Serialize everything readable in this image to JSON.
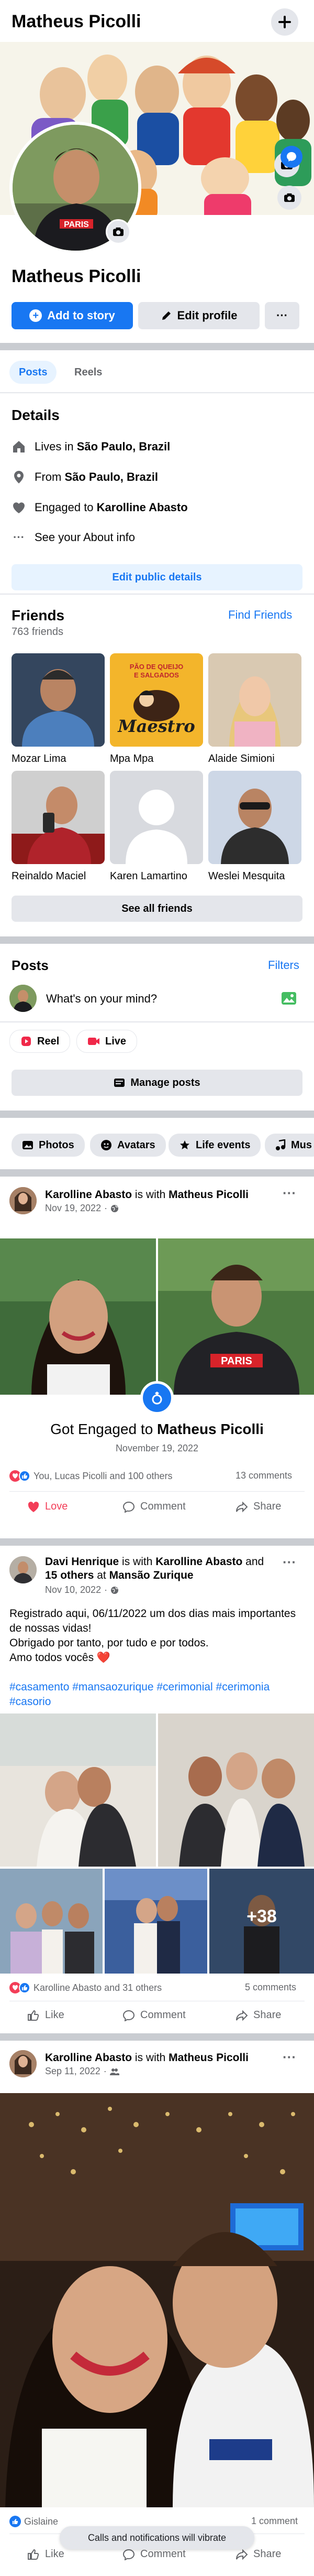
{
  "header": {
    "name": "Matheus Picolli",
    "plus_icon": "plus-icon"
  },
  "profile": {
    "display_name": "Matheus Picolli",
    "add_story_label": "Add to story",
    "edit_profile_label": "Edit profile",
    "more_label": "···"
  },
  "tabs": {
    "posts": "Posts",
    "reels": "Reels"
  },
  "details": {
    "heading": "Details",
    "lives_prefix": "Lives in ",
    "lives_value": "São Paulo, Brazil",
    "from_prefix": "From ",
    "from_value": "São Paulo, Brazil",
    "engaged_prefix": "Engaged to ",
    "engaged_value": "Karolline Abasto",
    "about_label": "See your About info",
    "edit_public_label": "Edit public details"
  },
  "friends": {
    "heading": "Friends",
    "count": "763 friends",
    "find_label": "Find Friends",
    "list": [
      {
        "name": "Mozar Lima"
      },
      {
        "name": "Mpa Mpa"
      },
      {
        "name": "Alaide Simioni"
      },
      {
        "name": "Reinaldo Maciel"
      },
      {
        "name": "Karen Lamartino"
      },
      {
        "name": "Weslei Mesquita"
      }
    ],
    "see_all_label": "See all friends",
    "maestro_line1": "PÃO DE QUEIJO",
    "maestro_line2": "E SALGADOS",
    "maestro_brand": "Maestro"
  },
  "posts_section": {
    "heading": "Posts",
    "filters_label": "Filters",
    "composer_placeholder": "What's on your mind?",
    "reel_label": "Reel",
    "live_label": "Live",
    "manage_label": "Manage posts"
  },
  "filter_chips": [
    {
      "label": "Photos"
    },
    {
      "label": "Avatars"
    },
    {
      "label": "Life events"
    },
    {
      "label": "Mus"
    }
  ],
  "post1": {
    "author": "Karolline Abasto",
    "with_text": " is with ",
    "tagged": "Matheus Picolli",
    "date": "Nov 19, 2022",
    "shirt_text": "PARIS",
    "event_prefix": "Got Engaged to ",
    "event_name": "Matheus Picolli",
    "event_date": "November 19, 2022",
    "reactions_text": "You, Lucas Picolli and 100 others",
    "comments_count": "13 comments",
    "love_label": "Love",
    "comment_label": "Comment",
    "share_label": "Share"
  },
  "post2": {
    "author": "Davi Henrique",
    "with_text": " is with ",
    "tagged": "Karolline Abasto",
    "and_text": " and ",
    "others": "15 others",
    "at_text": " at ",
    "place": "Mansão Zurique",
    "date": "Nov 10, 2022",
    "body_line1": "Registrado aqui, 06/11/2022 um dos dias mais importantes de nossas vidas!",
    "body_line2": "Obrigado por tanto, por tudo e por todos.",
    "body_line3": "Amo todos vocês ❤️",
    "hashtags": "#casamento #mansaozurique #cerimonial #cerimonia #casorio",
    "more_photos": "+38",
    "reactions_text": "Karolline Abasto and 31 others",
    "comments_count": "5 comments",
    "like_label": "Like",
    "comment_label": "Comment",
    "share_label": "Share"
  },
  "post3": {
    "author": "Karolline Abasto",
    "with_text": " is with ",
    "tagged": "Matheus Picolli",
    "date": "Sep 11, 2022",
    "reactions_text": "Gislaine",
    "comments_count": "1 comment",
    "like_label": "Like",
    "comment_label": "Comment",
    "share_label": "Share"
  },
  "toast": {
    "text": "Calls and notifications will vibrate"
  },
  "colors": {
    "accent": "#1877f2",
    "love": "#f33e58",
    "divider": "#c9ccd1"
  }
}
